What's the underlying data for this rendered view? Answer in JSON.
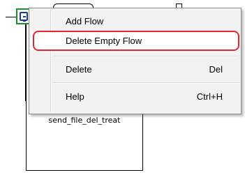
{
  "canvas": {
    "flow_label": "send_file_del_treat"
  },
  "context_menu": {
    "items": [
      {
        "label": "Add Flow",
        "shortcut": ""
      },
      {
        "label": "Delete Empty Flow",
        "shortcut": ""
      },
      {
        "label": "Delete",
        "shortcut": "Del"
      },
      {
        "label": "Help",
        "shortcut": "Ctrl+H"
      }
    ]
  },
  "colors": {
    "highlight": "#e8242c",
    "node_border": "#1a8f2b",
    "node_icon": "#1c3b8c",
    "menu_background": "#f2f2f2"
  },
  "icons": [
    "flow-node-icon"
  ]
}
